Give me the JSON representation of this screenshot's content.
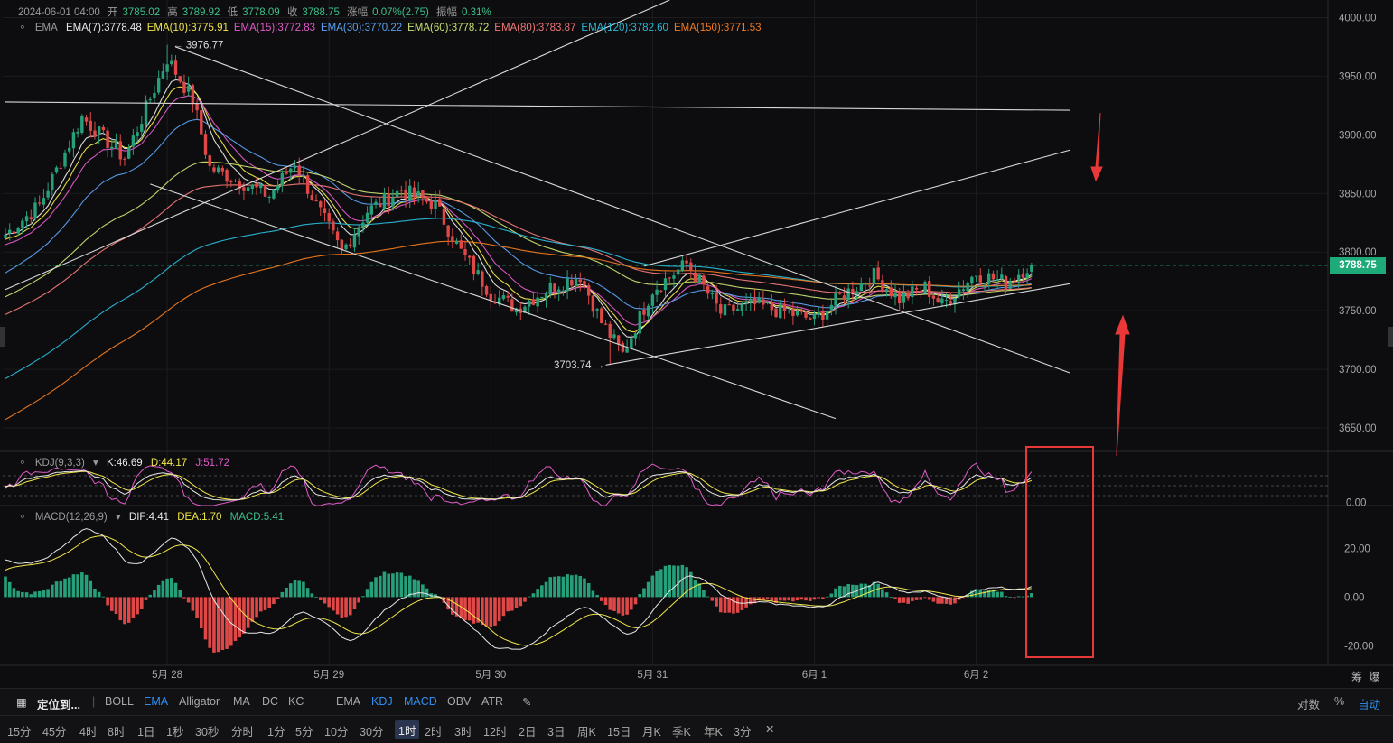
{
  "header": {
    "date": "2024-06-01 04:00",
    "open_label": "开",
    "open": "3785.02",
    "high_label": "高",
    "high": "3789.92",
    "low_label": "低",
    "low": "3778.09",
    "close_label": "收",
    "close": "3788.75",
    "change_label": "涨幅",
    "change": "0.07%(2.75)",
    "amplitude_label": "振幅",
    "amplitude": "0.31%"
  },
  "ema_legend": {
    "name": "EMA",
    "items": [
      {
        "label": "EMA(7):3778.48",
        "color": "#e8e8e8"
      },
      {
        "label": "EMA(10):3775.91",
        "color": "#f0e64a"
      },
      {
        "label": "EMA(15):3772.83",
        "color": "#e05ac8"
      },
      {
        "label": "EMA(30):3770.22",
        "color": "#5aa0f0"
      },
      {
        "label": "EMA(60):3778.72",
        "color": "#c8e070"
      },
      {
        "label": "EMA(80):3783.87",
        "color": "#f07878"
      },
      {
        "label": "EMA(120):3782.60",
        "color": "#2ab8d8"
      },
      {
        "label": "EMA(150):3771.53",
        "color": "#f07a20"
      }
    ]
  },
  "kdj_legend": {
    "name": "KDJ(9,3,3)",
    "k": "K:46.69",
    "d": "D:44.17",
    "j": "J:51.72",
    "k_color": "#e8e8e8",
    "d_color": "#f0e64a",
    "j_color": "#e05ac8"
  },
  "macd_legend": {
    "name": "MACD(12,26,9)",
    "dif": "DIF:4.41",
    "dea": "DEA:1.70",
    "macd": "MACD:5.41",
    "dif_color": "#e8e8e8",
    "dea_color": "#f0e64a",
    "macd_color": "#3ec08a"
  },
  "colors": {
    "up": "#26a07a",
    "down": "#e04848",
    "annotation": "#e83838"
  },
  "price_tag": "3788.75",
  "chart_data": {
    "type": "candlestick",
    "main": {
      "ylim": [
        3630,
        4015
      ],
      "y_ticks": [
        "4000.00",
        "3950.00",
        "3900.00",
        "3850.00",
        "3800.00",
        "3750.00",
        "3700.00",
        "3650.00"
      ],
      "y_tick_values": [
        4000,
        3950,
        3900,
        3850,
        3800,
        3750,
        3700,
        3650
      ],
      "annotations": [
        {
          "text": "3976.77",
          "value": 3976.77,
          "bar": 38
        },
        {
          "text": "3703.74",
          "value": 3703.74,
          "bar": 142
        }
      ],
      "last_price": 3788.75,
      "close_waypoints": [
        [
          0,
          3815
        ],
        [
          8,
          3840
        ],
        [
          18,
          3915
        ],
        [
          28,
          3880
        ],
        [
          38,
          3965
        ],
        [
          44,
          3930
        ],
        [
          48,
          3872
        ],
        [
          55,
          3860
        ],
        [
          62,
          3848
        ],
        [
          68,
          3877
        ],
        [
          73,
          3840
        ],
        [
          79,
          3800
        ],
        [
          85,
          3835
        ],
        [
          93,
          3853
        ],
        [
          101,
          3840
        ],
        [
          107,
          3800
        ],
        [
          114,
          3765
        ],
        [
          120,
          3752
        ],
        [
          128,
          3770
        ],
        [
          135,
          3780
        ],
        [
          140,
          3740
        ],
        [
          145,
          3713
        ],
        [
          152,
          3768
        ],
        [
          160,
          3790
        ],
        [
          164,
          3770
        ],
        [
          168,
          3748
        ],
        [
          176,
          3755
        ],
        [
          184,
          3748
        ],
        [
          190,
          3742
        ],
        [
          196,
          3762
        ],
        [
          204,
          3780
        ],
        [
          210,
          3760
        ],
        [
          216,
          3770
        ],
        [
          220,
          3755
        ],
        [
          228,
          3782
        ],
        [
          235,
          3774
        ],
        [
          241,
          3790
        ]
      ]
    },
    "kdj": {
      "ylim": [
        -10,
        140
      ],
      "y_ticks": [
        "0.00"
      ],
      "y_tick_values": [
        0
      ]
    },
    "macd": {
      "ylim": [
        -28,
        32
      ],
      "y_ticks": [
        "20.00",
        "0.00",
        "-20.00"
      ],
      "y_tick_values": [
        20,
        0,
        -20
      ]
    },
    "x_ticks": [
      {
        "label": "5月 28",
        "bar": 38
      },
      {
        "label": "5月 29",
        "bar": 76
      },
      {
        "label": "5月 30",
        "bar": 114
      },
      {
        "label": "5月 31",
        "bar": 152
      },
      {
        "label": "6月 1",
        "bar": 190
      },
      {
        "label": "6月 2",
        "bar": 228
      }
    ],
    "trendlines": [
      {
        "p1": [
          0,
          3928
        ],
        "p2": [
          250,
          3921
        ]
      },
      {
        "p1": [
          0,
          3768
        ],
        "p2": [
          156,
          4015
        ]
      },
      {
        "p1": [
          40,
          3975
        ],
        "p2": [
          250,
          3697
        ]
      },
      {
        "p1": [
          34,
          3858
        ],
        "p2": [
          195,
          3658
        ]
      },
      {
        "p1": [
          141,
          3703.7
        ],
        "p2": [
          250,
          3773
        ]
      },
      {
        "p1": [
          150,
          3788
        ],
        "p2": [
          250,
          3887
        ]
      }
    ]
  },
  "axis_corner": {
    "a": "筹",
    "b": "爆"
  },
  "toolbar1": {
    "locate": "定位到...",
    "items": [
      "BOLL",
      "EMA",
      "Alligator",
      "MA",
      "DC",
      "KC",
      "EMA",
      "KDJ",
      "MACD",
      "OBV",
      "ATR"
    ],
    "right": [
      "对数",
      "%",
      "自动"
    ]
  },
  "toolbar2": {
    "items": [
      "15分",
      "45分",
      "4时",
      "8时",
      "1日",
      "1秒",
      "30秒",
      "分时",
      "1分",
      "5分",
      "10分",
      "30分",
      "1时",
      "2时",
      "3时",
      "12时",
      "2日",
      "3日",
      "周K",
      "15日",
      "月K",
      "季K",
      "年K",
      "3分"
    ]
  }
}
